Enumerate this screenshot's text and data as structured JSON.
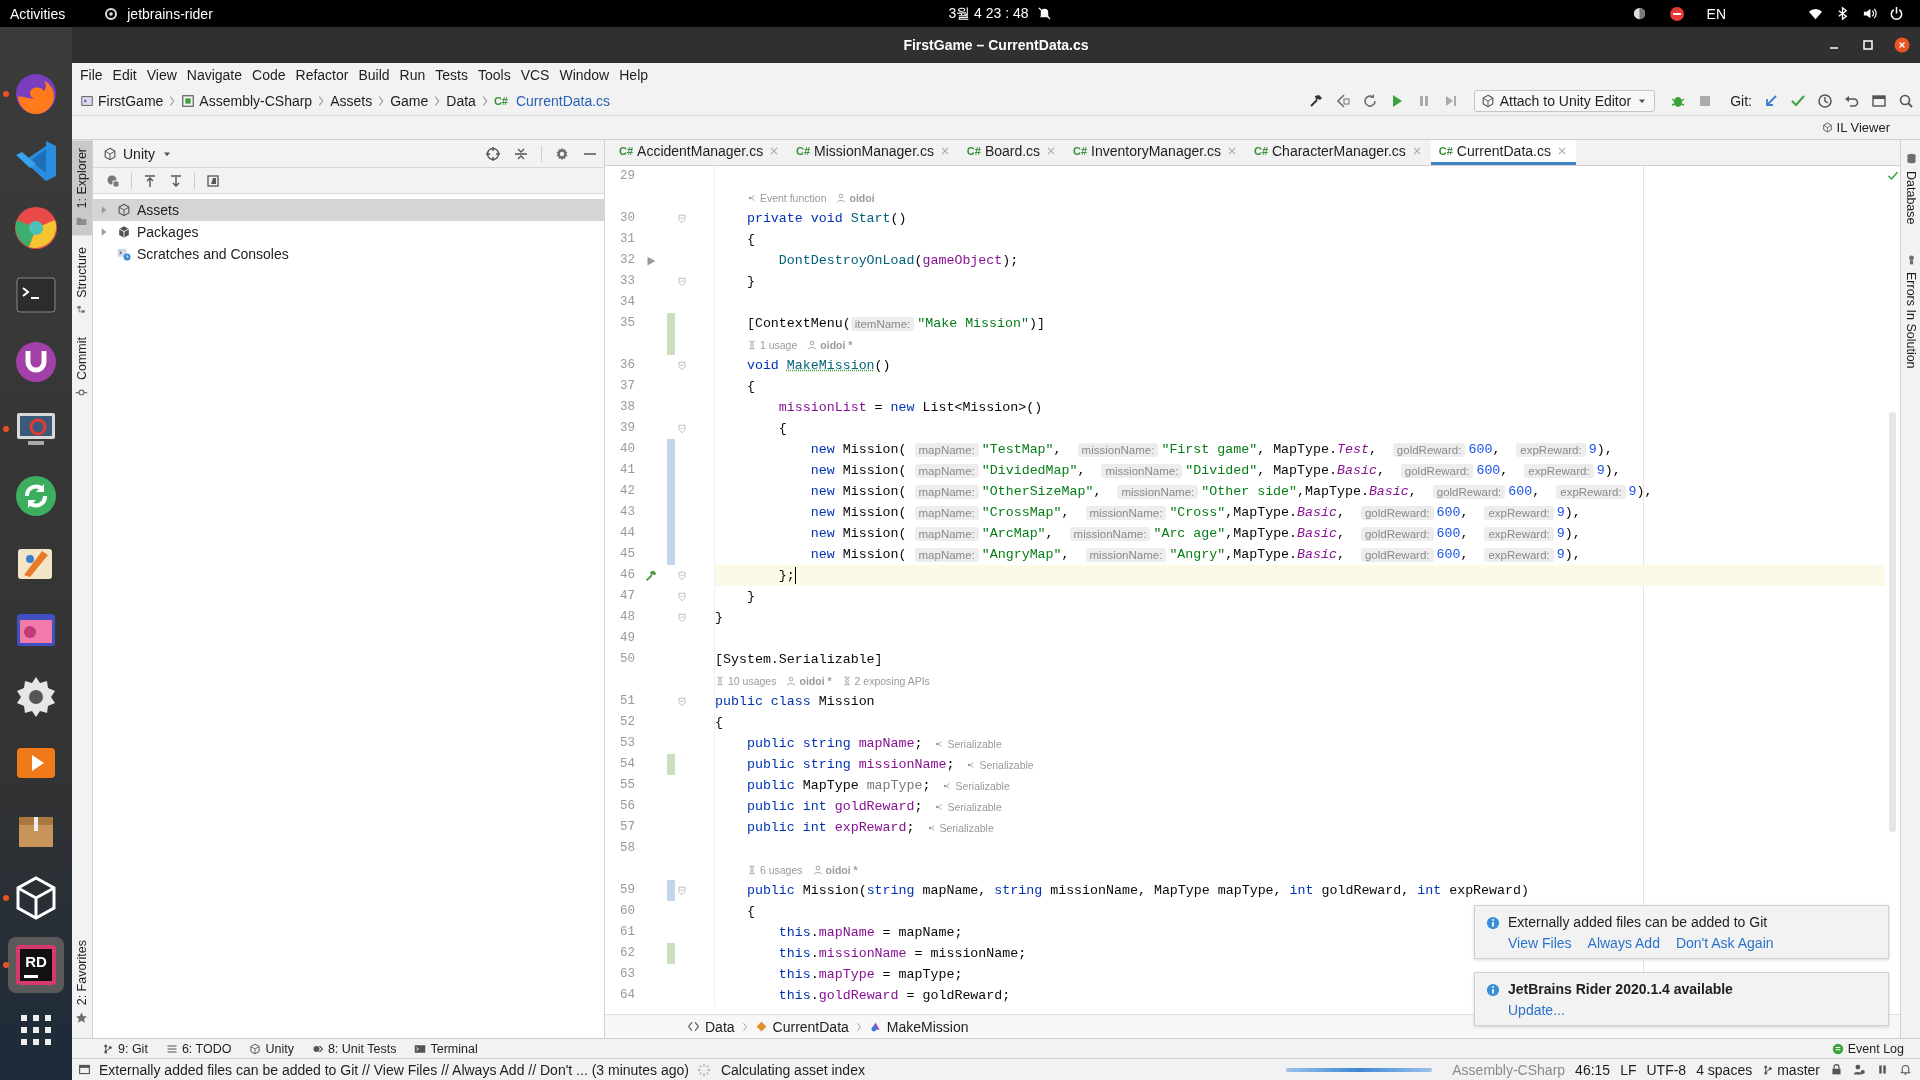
{
  "top_bar": {
    "activities": "Activities",
    "app": "jetbrains-rider",
    "clock": "3월 4 23 : 48",
    "language": "EN"
  },
  "dock": {
    "apps": [
      {
        "running": true,
        "selected": false
      },
      {
        "running": false,
        "selected": false
      },
      {
        "running": false,
        "selected": false
      },
      {
        "running": false,
        "selected": false
      },
      {
        "running": false,
        "selected": false
      },
      {
        "running": true,
        "selected": false
      },
      {
        "running": false,
        "selected": false
      },
      {
        "running": false,
        "selected": false
      },
      {
        "running": false,
        "selected": false
      },
      {
        "running": false,
        "selected": false
      },
      {
        "running": false,
        "selected": false
      },
      {
        "running": false,
        "selected": false
      },
      {
        "running": true,
        "selected": false
      },
      {
        "running": true,
        "selected": true,
        "text": "RD"
      }
    ]
  },
  "window": {
    "title": "FirstGame – CurrentData.cs"
  },
  "menu": [
    "File",
    "Edit",
    "View",
    "Navigate",
    "Code",
    "Refactor",
    "Build",
    "Run",
    "Tests",
    "Tools",
    "VCS",
    "Window",
    "Help"
  ],
  "breadcrumb": [
    {
      "label": "FirstGame",
      "kind": "project"
    },
    {
      "label": "Assembly-CSharp",
      "kind": "assembly"
    },
    {
      "label": "Assets",
      "kind": "folder"
    },
    {
      "label": "Game",
      "kind": "folder"
    },
    {
      "label": "Data",
      "kind": "folder"
    },
    {
      "label": "CurrentData.cs",
      "kind": "file",
      "lang": "C#"
    }
  ],
  "toolbar": {
    "run_config": "Attach to Unity Editor",
    "git_label": "Git:"
  },
  "il_viewer": "IL Viewer",
  "left_strip": {
    "top": [
      {
        "label": "1: Explorer",
        "kind": "explorer",
        "selected": true
      },
      {
        "label": "Structure",
        "kind": "structure",
        "selected": false
      },
      {
        "label": "Commit",
        "kind": "commit",
        "selected": false
      }
    ],
    "bottom": [
      {
        "label": "2: Favorites",
        "kind": "favorites",
        "selected": false
      }
    ]
  },
  "explorer": {
    "title": "Unity",
    "tree": [
      {
        "label": "Assets",
        "kind": "unity",
        "has_children": true,
        "expanded": false,
        "selected": true
      },
      {
        "label": "Packages",
        "kind": "package",
        "has_children": true,
        "expanded": false,
        "selected": false
      },
      {
        "label": "Scratches and Consoles",
        "kind": "scratches",
        "has_children": false,
        "selected": false
      }
    ]
  },
  "editor": {
    "tabs": [
      {
        "lang": "C#",
        "label": "AccidentManager.cs",
        "selected": false
      },
      {
        "lang": "C#",
        "label": "MissionManager.cs",
        "selected": false
      },
      {
        "lang": "C#",
        "label": "Board.cs",
        "selected": false
      },
      {
        "lang": "C#",
        "label": "InventoryManager.cs",
        "selected": false
      },
      {
        "lang": "C#",
        "label": "CharacterManager.cs",
        "selected": false
      },
      {
        "lang": "C#",
        "label": "CurrentData.cs",
        "selected": true
      }
    ],
    "lines": [
      {
        "n": "29"
      },
      {
        "vision": [
          {
            "kind": "event",
            "text": "Event function"
          },
          {
            "kind": "author",
            "text": "oidoi"
          }
        ]
      },
      {
        "n": "30",
        "fold": true,
        "segs": [
          {
            "kind": "kw",
            "text": "    private void "
          },
          {
            "kind": "fn",
            "text": "Start"
          },
          {
            "kind": "p",
            "text": "()"
          }
        ]
      },
      {
        "n": "31",
        "segs": [
          {
            "kind": "p",
            "text": "    {"
          }
        ]
      },
      {
        "n": "32",
        "gutter": {
          "kind": "run"
        },
        "segs": [
          {
            "kind": "fn",
            "text": "        DontDestroyOnLoad"
          },
          {
            "kind": "p",
            "text": "("
          },
          {
            "kind": "fld",
            "text": "gameObject"
          },
          {
            "kind": "p",
            "text": ");"
          }
        ]
      },
      {
        "n": "33",
        "fold": true,
        "segs": [
          {
            "kind": "p",
            "text": "    }"
          }
        ]
      },
      {
        "n": "34"
      },
      {
        "n": "35",
        "change": {
          "kind": "added"
        },
        "segs": [
          {
            "kind": "p",
            "text": "    [ContextMenu("
          },
          {
            "kind": "hint",
            "text": "itemName:"
          },
          {
            "kind": "str",
            "text": "\"Make Mission\""
          },
          {
            "kind": "p",
            "text": ")]"
          }
        ]
      },
      {
        "change": {
          "kind": "added"
        },
        "vision": [
          {
            "kind": "usages",
            "text": "1 usage"
          },
          {
            "kind": "author",
            "text": "oidoi *"
          }
        ]
      },
      {
        "n": "36",
        "fold": true,
        "segs": [
          {
            "kind": "kw",
            "text": "    void "
          },
          {
            "kind": "fnu",
            "text": "MakeMission"
          },
          {
            "kind": "p",
            "text": "()"
          }
        ]
      },
      {
        "n": "37",
        "segs": [
          {
            "kind": "p",
            "text": "    {"
          }
        ]
      },
      {
        "n": "38",
        "segs": [
          {
            "kind": "fld",
            "text": "        missionList"
          },
          {
            "kind": "p",
            "text": " = "
          },
          {
            "kind": "kw",
            "text": "new "
          },
          {
            "kind": "p",
            "text": "List<Mission>()"
          }
        ]
      },
      {
        "n": "39",
        "fold": true,
        "segs": [
          {
            "kind": "p",
            "text": "        {"
          }
        ]
      },
      {
        "n": "40",
        "change": {
          "kind": "modified"
        },
        "segs": [
          {
            "kind": "kw",
            "text": "            new "
          },
          {
            "kind": "p",
            "text": "Mission( "
          },
          {
            "kind": "hint",
            "text": "mapName:"
          },
          {
            "kind": "str",
            "text": "\"TestMap\""
          },
          {
            "kind": "p",
            "text": ",  "
          },
          {
            "kind": "hint",
            "text": "missionName:"
          },
          {
            "kind": "str",
            "text": "\"First game\""
          },
          {
            "kind": "p",
            "text": ", MapType."
          },
          {
            "kind": "en",
            "text": "Test"
          },
          {
            "kind": "p",
            "text": ",  "
          },
          {
            "kind": "hint",
            "text": "goldReward:"
          },
          {
            "kind": "num",
            "text": "600"
          },
          {
            "kind": "p",
            "text": ",  "
          },
          {
            "kind": "hint",
            "text": "expReward:"
          },
          {
            "kind": "num",
            "text": "9"
          },
          {
            "kind": "p",
            "text": "),"
          }
        ]
      },
      {
        "n": "41",
        "change": {
          "kind": "modified"
        },
        "segs": [
          {
            "kind": "kw",
            "text": "            new "
          },
          {
            "kind": "p",
            "text": "Mission( "
          },
          {
            "kind": "hint",
            "text": "mapName:"
          },
          {
            "kind": "str",
            "text": "\"DividedMap\""
          },
          {
            "kind": "p",
            "text": ",  "
          },
          {
            "kind": "hint",
            "text": "missionName:"
          },
          {
            "kind": "str",
            "text": "\"Divided\""
          },
          {
            "kind": "p",
            "text": ", MapType."
          },
          {
            "kind": "en",
            "text": "Basic"
          },
          {
            "kind": "p",
            "text": ",  "
          },
          {
            "kind": "hint",
            "text": "goldReward:"
          },
          {
            "kind": "num",
            "text": "600"
          },
          {
            "kind": "p",
            "text": ",  "
          },
          {
            "kind": "hint",
            "text": "expReward:"
          },
          {
            "kind": "num",
            "text": "9"
          },
          {
            "kind": "p",
            "text": "),"
          }
        ]
      },
      {
        "n": "42",
        "change": {
          "kind": "modified"
        },
        "segs": [
          {
            "kind": "kw",
            "text": "            new "
          },
          {
            "kind": "p",
            "text": "Mission( "
          },
          {
            "kind": "hint",
            "text": "mapName:"
          },
          {
            "kind": "str",
            "text": "\"OtherSizeMap\""
          },
          {
            "kind": "p",
            "text": ",  "
          },
          {
            "kind": "hint",
            "text": "missionName:"
          },
          {
            "kind": "str",
            "text": "\"Other side\""
          },
          {
            "kind": "p",
            "text": ",MapType."
          },
          {
            "kind": "en",
            "text": "Basic"
          },
          {
            "kind": "p",
            "text": ",  "
          },
          {
            "kind": "hint",
            "text": "goldReward:"
          },
          {
            "kind": "num",
            "text": "600"
          },
          {
            "kind": "p",
            "text": ",  "
          },
          {
            "kind": "hint",
            "text": "expReward:"
          },
          {
            "kind": "num",
            "text": "9"
          },
          {
            "kind": "p",
            "text": "),"
          }
        ]
      },
      {
        "n": "43",
        "change": {
          "kind": "modified"
        },
        "segs": [
          {
            "kind": "kw",
            "text": "            new "
          },
          {
            "kind": "p",
            "text": "Mission( "
          },
          {
            "kind": "hint",
            "text": "mapName:"
          },
          {
            "kind": "str",
            "text": "\"CrossMap\""
          },
          {
            "kind": "p",
            "text": ",  "
          },
          {
            "kind": "hint",
            "text": "missionName:"
          },
          {
            "kind": "str",
            "text": "\"Cross\""
          },
          {
            "kind": "p",
            "text": ",MapType."
          },
          {
            "kind": "en",
            "text": "Basic"
          },
          {
            "kind": "p",
            "text": ",  "
          },
          {
            "kind": "hint",
            "text": "goldReward:"
          },
          {
            "kind": "num",
            "text": "600"
          },
          {
            "kind": "p",
            "text": ",  "
          },
          {
            "kind": "hint",
            "text": "expReward:"
          },
          {
            "kind": "num",
            "text": "9"
          },
          {
            "kind": "p",
            "text": "),"
          }
        ]
      },
      {
        "n": "44",
        "change": {
          "kind": "modified"
        },
        "segs": [
          {
            "kind": "kw",
            "text": "            new "
          },
          {
            "kind": "p",
            "text": "Mission( "
          },
          {
            "kind": "hint",
            "text": "mapName:"
          },
          {
            "kind": "str",
            "text": "\"ArcMap\""
          },
          {
            "kind": "p",
            "text": ",  "
          },
          {
            "kind": "hint",
            "text": "missionName:"
          },
          {
            "kind": "str",
            "text": "\"Arc age\""
          },
          {
            "kind": "p",
            "text": ",MapType."
          },
          {
            "kind": "en",
            "text": "Basic"
          },
          {
            "kind": "p",
            "text": ",  "
          },
          {
            "kind": "hint",
            "text": "goldReward:"
          },
          {
            "kind": "num",
            "text": "600"
          },
          {
            "kind": "p",
            "text": ",  "
          },
          {
            "kind": "hint",
            "text": "expReward:"
          },
          {
            "kind": "num",
            "text": "9"
          },
          {
            "kind": "p",
            "text": "),"
          }
        ]
      },
      {
        "n": "45",
        "change": {
          "kind": "modified"
        },
        "segs": [
          {
            "kind": "kw",
            "text": "            new "
          },
          {
            "kind": "p",
            "text": "Mission( "
          },
          {
            "kind": "hint",
            "text": "mapName:"
          },
          {
            "kind": "str",
            "text": "\"AngryMap\""
          },
          {
            "kind": "p",
            "text": ",  "
          },
          {
            "kind": "hint",
            "text": "missionName:"
          },
          {
            "kind": "str",
            "text": "\"Angry\""
          },
          {
            "kind": "p",
            "text": ",MapType."
          },
          {
            "kind": "en",
            "text": "Basic"
          },
          {
            "kind": "p",
            "text": ",  "
          },
          {
            "kind": "hint",
            "text": "goldReward:"
          },
          {
            "kind": "num",
            "text": "600"
          },
          {
            "kind": "p",
            "text": ",  "
          },
          {
            "kind": "hint",
            "text": "expReward:"
          },
          {
            "kind": "num",
            "text": "9"
          },
          {
            "kind": "p",
            "text": "),"
          }
        ]
      },
      {
        "n": "46",
        "fold": true,
        "gutter": {
          "kind": "build"
        },
        "current": true,
        "segs": [
          {
            "kind": "p",
            "text": "        };"
          }
        ]
      },
      {
        "n": "47",
        "fold": true,
        "segs": [
          {
            "kind": "p",
            "text": "    }"
          }
        ]
      },
      {
        "n": "48",
        "fold": true,
        "segs": [
          {
            "kind": "p",
            "text": "}"
          }
        ]
      },
      {
        "n": "49"
      },
      {
        "n": "50",
        "segs": [
          {
            "kind": "p",
            "text": "[System.Serializable]"
          }
        ]
      },
      {
        "vision": [
          {
            "kind": "usages",
            "text": "10 usages"
          },
          {
            "kind": "author",
            "text": "oidoi *"
          },
          {
            "kind": "usages",
            "text": "2 exposing APIs"
          }
        ]
      },
      {
        "n": "51",
        "fold": true,
        "segs": [
          {
            "kind": "kw",
            "text": "public class "
          },
          {
            "kind": "p",
            "text": "Mission"
          }
        ]
      },
      {
        "n": "52",
        "segs": [
          {
            "kind": "p",
            "text": "{"
          }
        ]
      },
      {
        "n": "53",
        "trail": "Serializable",
        "segs": [
          {
            "kind": "kw",
            "text": "    public string "
          },
          {
            "kind": "fld",
            "text": "mapName"
          },
          {
            "kind": "p",
            "text": ";"
          }
        ]
      },
      {
        "n": "54",
        "change": {
          "kind": "added"
        },
        "trail": "Serializable",
        "segs": [
          {
            "kind": "kw",
            "text": "    public string "
          },
          {
            "kind": "fld",
            "text": "missionName"
          },
          {
            "kind": "p",
            "text": ";"
          }
        ]
      },
      {
        "n": "55",
        "trail": "Serializable",
        "segs": [
          {
            "kind": "kw",
            "text": "    public "
          },
          {
            "kind": "p",
            "text": "MapType "
          },
          {
            "kind": "un",
            "text": "mapType"
          },
          {
            "kind": "p",
            "text": ";"
          }
        ]
      },
      {
        "n": "56",
        "trail": "Serializable",
        "segs": [
          {
            "kind": "kw",
            "text": "    public int "
          },
          {
            "kind": "fld",
            "text": "goldReward"
          },
          {
            "kind": "p",
            "text": ";"
          }
        ]
      },
      {
        "n": "57",
        "trail": "Serializable",
        "segs": [
          {
            "kind": "kw",
            "text": "    public int "
          },
          {
            "kind": "fld",
            "text": "expReward"
          },
          {
            "kind": "p",
            "text": ";"
          }
        ]
      },
      {
        "n": "58"
      },
      {
        "vision": [
          {
            "kind": "usages",
            "text": "6 usages"
          },
          {
            "kind": "author",
            "text": "oidoi *"
          }
        ]
      },
      {
        "n": "59",
        "fold": true,
        "change": {
          "kind": "modified"
        },
        "segs": [
          {
            "kind": "kw",
            "text": "    public "
          },
          {
            "kind": "p",
            "text": "Mission("
          },
          {
            "kind": "kw",
            "text": "string "
          },
          {
            "kind": "p",
            "text": "mapName, "
          },
          {
            "kind": "kw",
            "text": "string "
          },
          {
            "kind": "p",
            "text": "missionName, MapType mapType, "
          },
          {
            "kind": "kw",
            "text": "int "
          },
          {
            "kind": "p",
            "text": "goldReward, "
          },
          {
            "kind": "kw",
            "text": "int "
          },
          {
            "kind": "p",
            "text": "expReward)"
          }
        ]
      },
      {
        "n": "60",
        "segs": [
          {
            "kind": "p",
            "text": "    {"
          }
        ]
      },
      {
        "n": "61",
        "segs": [
          {
            "kind": "kw",
            "text": "        this"
          },
          {
            "kind": "p",
            "text": "."
          },
          {
            "kind": "fld",
            "text": "mapName"
          },
          {
            "kind": "p",
            "text": " = mapName;"
          }
        ]
      },
      {
        "n": "62",
        "change": {
          "kind": "added"
        },
        "segs": [
          {
            "kind": "kw",
            "text": "        this"
          },
          {
            "kind": "p",
            "text": "."
          },
          {
            "kind": "fld",
            "text": "missionName"
          },
          {
            "kind": "p",
            "text": " = missionName;"
          }
        ]
      },
      {
        "n": "63",
        "segs": [
          {
            "kind": "kw",
            "text": "        this"
          },
          {
            "kind": "p",
            "text": "."
          },
          {
            "kind": "fld",
            "text": "mapType"
          },
          {
            "kind": "p",
            "text": " = mapType;"
          }
        ]
      },
      {
        "n": "64",
        "segs": [
          {
            "kind": "kw",
            "text": "        this"
          },
          {
            "kind": "p",
            "text": "."
          },
          {
            "kind": "fld",
            "text": "goldReward"
          },
          {
            "kind": "p",
            "text": " = goldReward;"
          }
        ]
      }
    ],
    "breadcrumb": [
      {
        "label": "Data",
        "kind": "namespace"
      },
      {
        "label": "CurrentData",
        "kind": "class"
      },
      {
        "label": "MakeMission",
        "kind": "method"
      }
    ]
  },
  "right_strip": [
    {
      "label": "Database",
      "kind": "database"
    },
    {
      "label": "Errors In Solution",
      "kind": "errors"
    }
  ],
  "notifications": [
    {
      "message": "Externally added files can be added to Git",
      "bold": false,
      "actions": [
        "View Files",
        "Always Add",
        "Don't Ask Again"
      ]
    },
    {
      "message": "JetBrains Rider 2020.1.4 available",
      "bold": true,
      "actions": [
        "Update..."
      ]
    }
  ],
  "tool_windows": {
    "left": [
      {
        "label": "9: Git",
        "kind": "git"
      },
      {
        "label": "6: TODO",
        "kind": "todo"
      },
      {
        "label": "Unity",
        "kind": "unity"
      },
      {
        "label": "8: Unit Tests",
        "kind": "tests"
      },
      {
        "label": "Terminal",
        "kind": "terminal"
      }
    ],
    "right": [
      {
        "label": "Event Log",
        "kind": "log"
      }
    ]
  },
  "status_bar": {
    "message": "Externally added files can be added to Git // View Files // Always Add // Don't ... (3 minutes ago)",
    "task": "Calculating asset index",
    "progress": {
      "level": 1
    },
    "context": "Assembly-CSharp",
    "position": "46:15",
    "line_separator": "LF",
    "encoding": "UTF-8",
    "indent": "4 spaces",
    "branch": "master"
  }
}
